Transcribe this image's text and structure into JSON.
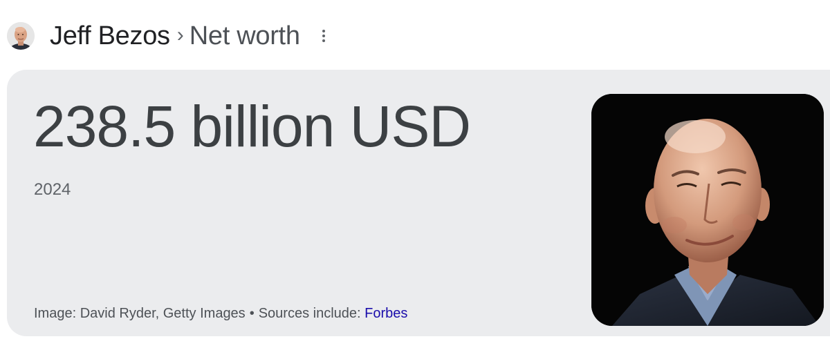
{
  "header": {
    "entity_name": "Jeff Bezos",
    "separator": "›",
    "topic": "Net worth"
  },
  "card": {
    "value": "238.5 billion USD",
    "year": "2024",
    "image_credit": "Image: David Ryder, Getty Images",
    "bullet": "•",
    "sources_label": "Sources include:",
    "source_link": "Forbes"
  },
  "icons": {
    "more": "more-vert-icon",
    "avatar": "person-avatar",
    "photo": "person-photo"
  },
  "colors": {
    "card_background": "#ebecee",
    "link": "#1a0dab",
    "value_text": "#3c4043",
    "photo_background": "#050505"
  }
}
